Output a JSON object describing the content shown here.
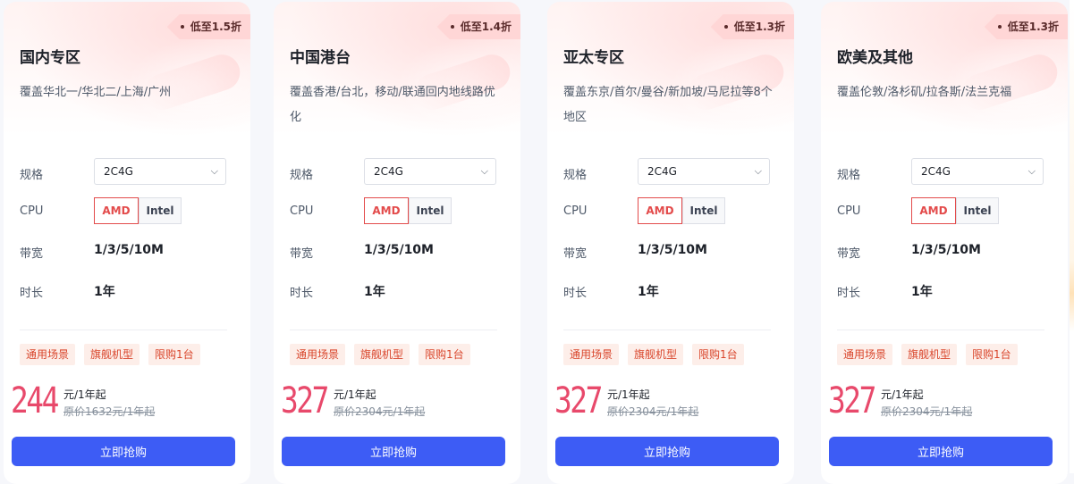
{
  "labels": {
    "spec": "规格",
    "cpu": "CPU",
    "bandwidth": "带宽",
    "duration": "时长",
    "buy": "立即抢购"
  },
  "cards": [
    {
      "discount": "低至1.5折",
      "title": "国内专区",
      "desc": "覆盖华北一/华北二/上海/广州",
      "spec": "2C4G",
      "cpu_options": [
        "AMD",
        "Intel"
      ],
      "cpu_selected": "AMD",
      "bandwidth": "1/3/5/10M",
      "duration": "1年",
      "tags": [
        "通用场景",
        "旗舰机型",
        "限购1台"
      ],
      "price": "244",
      "price_unit": "元/1年起",
      "original_price": "原价1632元/1年起"
    },
    {
      "discount": "低至1.4折",
      "title": "中国港台",
      "desc": "覆盖香港/台北，移动/联通回内地线路优化",
      "spec": "2C4G",
      "cpu_options": [
        "AMD",
        "Intel"
      ],
      "cpu_selected": "AMD",
      "bandwidth": "1/3/5/10M",
      "duration": "1年",
      "tags": [
        "通用场景",
        "旗舰机型",
        "限购1台"
      ],
      "price": "327",
      "price_unit": "元/1年起",
      "original_price": "原价2304元/1年起"
    },
    {
      "discount": "低至1.3折",
      "title": "亚太专区",
      "desc": "覆盖东京/首尔/曼谷/新加坡/马尼拉等8个地区",
      "spec": "2C4G",
      "cpu_options": [
        "AMD",
        "Intel"
      ],
      "cpu_selected": "AMD",
      "bandwidth": "1/3/5/10M",
      "duration": "1年",
      "tags": [
        "通用场景",
        "旗舰机型",
        "限购1台"
      ],
      "price": "327",
      "price_unit": "元/1年起",
      "original_price": "原价2304元/1年起"
    },
    {
      "discount": "低至1.3折",
      "title": "欧美及其他",
      "desc": "覆盖伦敦/洛杉矶/拉各斯/法兰克福",
      "spec": "2C4G",
      "cpu_options": [
        "AMD",
        "Intel"
      ],
      "cpu_selected": "AMD",
      "bandwidth": "1/3/5/10M",
      "duration": "1年",
      "tags": [
        "通用场景",
        "旗舰机型",
        "限购1台"
      ],
      "price": "327",
      "price_unit": "元/1年起",
      "original_price": "原价2304元/1年起"
    }
  ],
  "colors": {
    "accent": "#3d5cf5",
    "price": "#e8496b",
    "selected_border": "#e34b4b",
    "tag_text": "#d9452b",
    "tag_bg": "#fdeee9"
  }
}
